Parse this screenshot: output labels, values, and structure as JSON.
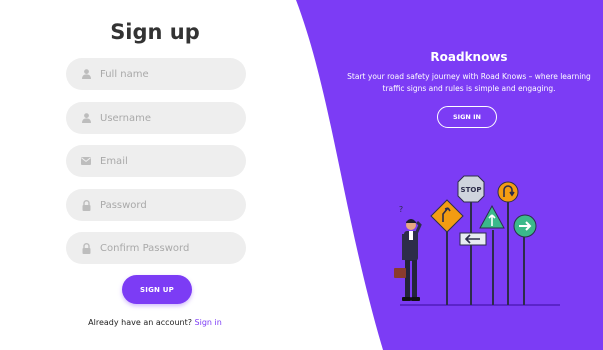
{
  "signup": {
    "title": "Sign up",
    "fields": [
      {
        "placeholder": "Full name",
        "icon": "user-icon"
      },
      {
        "placeholder": "Username",
        "icon": "user-icon"
      },
      {
        "placeholder": "Email",
        "icon": "envelope-icon"
      },
      {
        "placeholder": "Password",
        "icon": "lock-icon"
      },
      {
        "placeholder": "Confirm Password",
        "icon": "lock-icon"
      }
    ],
    "button_label": "SIGN UP",
    "account_prompt": "Already have an account?",
    "signin_link": "Sign in"
  },
  "hero": {
    "title": "Roadknows",
    "text": "Start your road safety journey with Road Knows – where learning traffic signs and rules is simple and engaging.",
    "button_label": "SIGN IN",
    "stop_sign_text": "STOP"
  },
  "colors": {
    "accent": "#7c3cf5",
    "field_bg": "#eeeeee"
  }
}
